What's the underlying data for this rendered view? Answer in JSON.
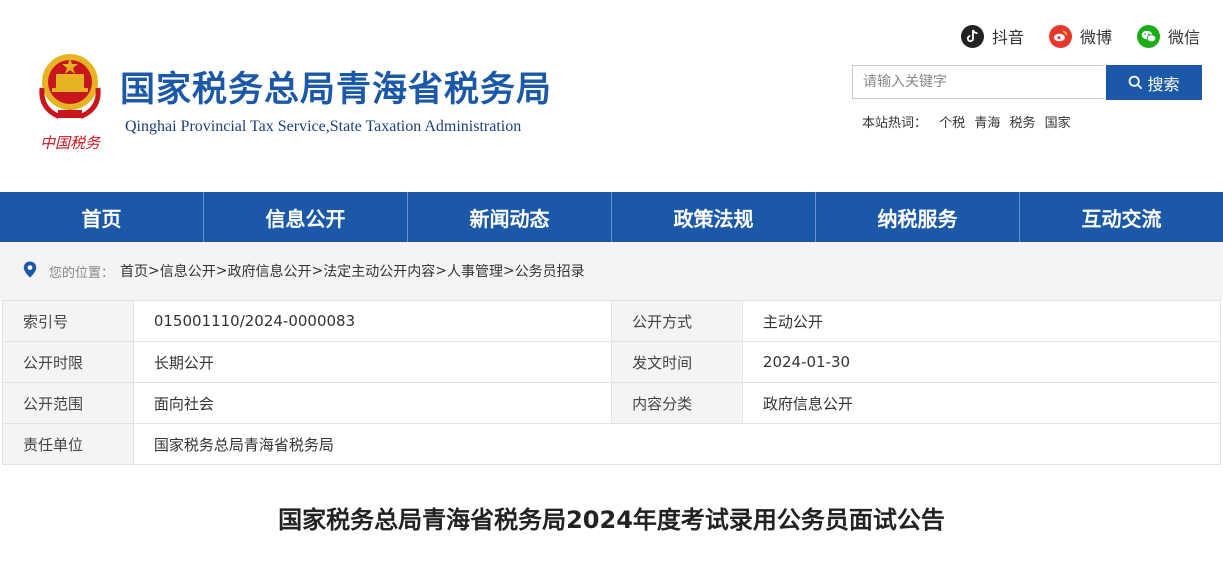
{
  "header": {
    "title_cn": "国家税务总局青海省税务局",
    "title_en": "Qinghai Provincial Tax Service,State Taxation Administration",
    "emblem_caption": "中国税务"
  },
  "social": [
    {
      "label": "抖音",
      "icon": "douyin-icon",
      "color": "#222222"
    },
    {
      "label": "微博",
      "icon": "weibo-icon",
      "color": "#e6372d"
    },
    {
      "label": "微信",
      "icon": "wechat-icon",
      "color": "#1aad19"
    }
  ],
  "search": {
    "placeholder": "请输入关键字",
    "button_label": "搜索",
    "hot_label": "本站热词：",
    "hot_words": [
      "个税",
      "青海",
      "税务",
      "国家"
    ]
  },
  "nav": [
    "首页",
    "信息公开",
    "新闻动态",
    "政策法规",
    "纳税服务",
    "互动交流"
  ],
  "breadcrumb": {
    "label": "您的位置：",
    "items": [
      "首页",
      "信息公开",
      "政府信息公开",
      "法定主动公开内容",
      "人事管理",
      "公务员招录"
    ]
  },
  "meta": {
    "index_no": {
      "k": "索引号",
      "v": "015001110/2024-0000083"
    },
    "method": {
      "k": "公开方式",
      "v": "主动公开"
    },
    "period": {
      "k": "公开时限",
      "v": "长期公开"
    },
    "date": {
      "k": "发文时间",
      "v": "2024-01-30"
    },
    "scope": {
      "k": "公开范围",
      "v": "面向社会"
    },
    "category": {
      "k": "内容分类",
      "v": "政府信息公开"
    },
    "unit": {
      "k": "责任单位",
      "v": "国家税务总局青海省税务局"
    }
  },
  "article": {
    "title": "国家税务总局青海省税务局2024年度考试录用公务员面试公告"
  },
  "colors": {
    "brand_blue": "#1b59a8",
    "emblem_red": "#c8161d",
    "emblem_gold": "#e6b422"
  }
}
